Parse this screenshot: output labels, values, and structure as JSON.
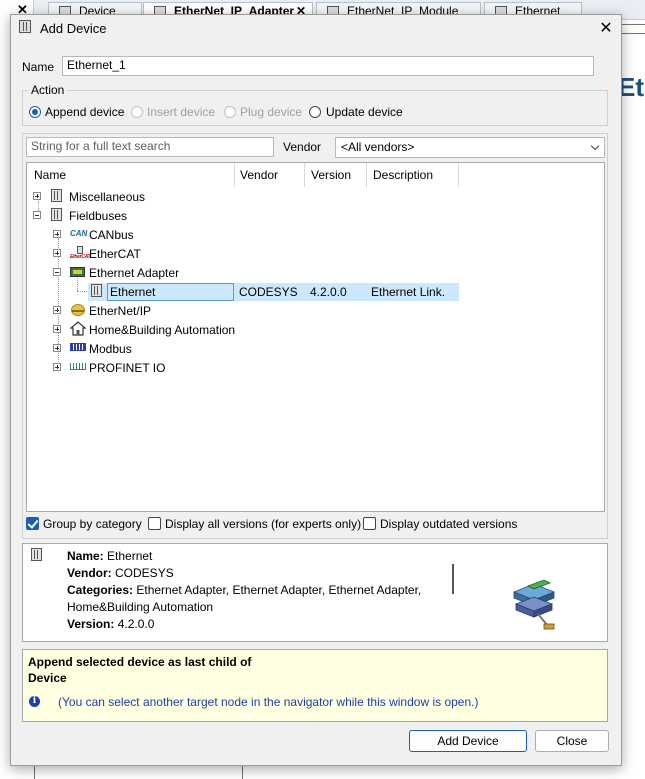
{
  "background": {
    "close_tab": "✕",
    "tabs": [
      {
        "label": "Device"
      },
      {
        "label": "EtherNet_IP_Adapter",
        "close": "✕"
      },
      {
        "label": "EtherNet_IP_Module"
      },
      {
        "label": "Ethernet"
      }
    ],
    "heading_fragment": "Et"
  },
  "dialog": {
    "title": "Add Device",
    "close": "✕",
    "name_label": "Name",
    "name_value": "Ethernet_1",
    "action_label": "Action",
    "actions": [
      {
        "label": "Append device",
        "checked": true,
        "enabled": true
      },
      {
        "label": "Insert device",
        "checked": false,
        "enabled": false
      },
      {
        "label": "Plug device",
        "checked": false,
        "enabled": false
      },
      {
        "label": "Update device",
        "checked": false,
        "enabled": true
      }
    ],
    "search_placeholder": "String for a full text search",
    "vendor_label": "Vendor",
    "vendor_value": "<All vendors>",
    "columns": [
      "Name",
      "Vendor",
      "Version",
      "Description"
    ],
    "tree": [
      {
        "label": "Miscellaneous",
        "level": 0,
        "expander": "plus",
        "icon": "device-icon"
      },
      {
        "label": "Fieldbuses",
        "level": 0,
        "expander": "minus",
        "icon": "device-icon"
      },
      {
        "label": "CANbus",
        "level": 1,
        "expander": "plus",
        "icon": "can-icon"
      },
      {
        "label": "EtherCAT",
        "level": 1,
        "expander": "plus",
        "icon": "ethercat-icon"
      },
      {
        "label": "Ethernet Adapter",
        "level": 1,
        "expander": "minus",
        "icon": "ethernet-adapter-icon"
      },
      {
        "label": "Ethernet",
        "level": 2,
        "expander": "none",
        "icon": "device-icon",
        "vendor": "CODESYS",
        "version": "4.2.0.0",
        "description": "Ethernet Link.",
        "selected": true
      },
      {
        "label": "EtherNet/IP",
        "level": 1,
        "expander": "plus",
        "icon": "ethernet-ip-icon"
      },
      {
        "label": "Home&Building Automation",
        "level": 1,
        "expander": "plus",
        "icon": "house-icon"
      },
      {
        "label": "Modbus",
        "level": 1,
        "expander": "plus",
        "icon": "modbus-icon"
      },
      {
        "label": "PROFINET IO",
        "level": 1,
        "expander": "plus",
        "icon": "profinet-icon"
      }
    ],
    "icon_text": {
      "can": "CAN",
      "ethercat": "EtherCAT"
    },
    "options": [
      {
        "label": "Group by category",
        "checked": true
      },
      {
        "label": "Display all versions (for experts only)",
        "checked": false
      },
      {
        "label": "Display outdated versions",
        "checked": false
      }
    ],
    "info": {
      "name_key": "Name:",
      "name_val": "Ethernet",
      "vendor_key": "Vendor:",
      "vendor_val": "CODESYS",
      "categories_key": "Categories:",
      "categories_val": "Ethernet Adapter, Ethernet Adapter, Ethernet Adapter,",
      "categories_val2": "Home&Building Automation",
      "version_key": "Version:",
      "version_val": "4.2.0.0"
    },
    "message": {
      "line1": "Append selected device as last child of",
      "line2": "Device",
      "hint": "(You can select another target node in the navigator while this window is open.)"
    },
    "buttons": {
      "add": "Add Device",
      "close": "Close"
    },
    "colors": {
      "accent": "#1a5fb4",
      "selection": "#cce8ff",
      "message_bg": "#ffffe1",
      "hint_text": "#1f3fa8"
    }
  }
}
